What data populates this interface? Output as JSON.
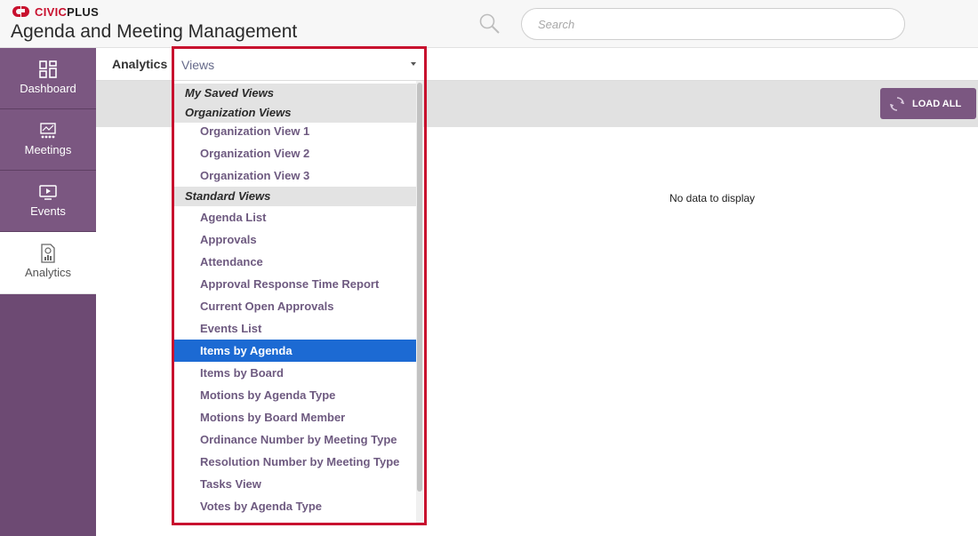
{
  "header": {
    "logo_prefix": "CIVIC",
    "logo_suffix": "PLUS",
    "app_title": "Agenda and Meeting Management",
    "search_placeholder": "Search"
  },
  "sidebar": {
    "items": [
      {
        "label": "Dashboard",
        "icon": "dashboard-icon",
        "active": false
      },
      {
        "label": "Meetings",
        "icon": "meetings-icon",
        "active": false
      },
      {
        "label": "Events",
        "icon": "events-icon",
        "active": false
      },
      {
        "label": "Analytics",
        "icon": "analytics-icon",
        "active": true
      }
    ]
  },
  "subbar": {
    "title": "Analytics",
    "views_value": "Views"
  },
  "toolbar": {
    "load_all_label": "LOAD ALL"
  },
  "main": {
    "empty_message": "No data to display"
  },
  "dropdown": {
    "groups": [
      {
        "label": "My Saved Views",
        "options": []
      },
      {
        "label": "Organization Views",
        "options": [
          "Organization View 1",
          "Organization View 2",
          "Organization View 3"
        ]
      },
      {
        "label": "Standard Views",
        "options": [
          "Agenda List",
          "Approvals",
          "Attendance",
          "Approval Response Time Report",
          "Current Open Approvals",
          "Events List",
          "Items by Agenda",
          "Items by Board",
          "Motions by Agenda Type",
          "Motions by Board Member",
          "Ordinance Number by Meeting Type",
          "Resolution Number by Meeting Type",
          "Tasks View",
          "Votes by Agenda Type"
        ]
      }
    ],
    "selected": "Items by Agenda"
  },
  "colors": {
    "brand_red": "#c8102e",
    "sidebar_purple": "#7b5781",
    "selected_blue": "#1c6ad3",
    "option_text": "#6e5a80"
  }
}
